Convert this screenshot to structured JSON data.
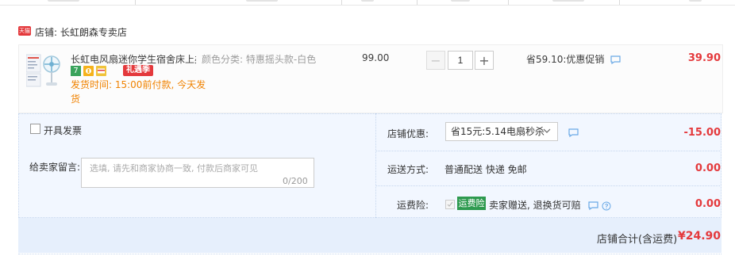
{
  "shop": {
    "name": "店铺: 长虹朗森专卖店",
    "badge": "天猫"
  },
  "item": {
    "title": "长虹电风扇迷你学生宿舍床上办...",
    "sku": "颜色分类: 特惠摇头款-白色",
    "price": "99.00",
    "quantity": "1",
    "minus": "−",
    "plus": "+",
    "promo": "省59.10:优惠促销",
    "total": "39.90",
    "badges": {
      "seven": "7",
      "gift": "礼遇季"
    },
    "ship_line1": "发货时间: 15:00前付款, 今天发",
    "ship_line2": "货"
  },
  "options": {
    "invoice_label": "开具发票",
    "message_label": "给卖家留言:",
    "message_placeholder": "选填, 请先和商家协商一致, 付款后商家可见",
    "message_count": "0/200"
  },
  "right": {
    "coupon_label": "店铺优惠:",
    "coupon_value": "省15元:5.14电扇秒杀",
    "coupon_discount": "-15.00",
    "ship_label": "运送方式:",
    "ship_value": "普通配送 快递 免邮",
    "ship_cost": "0.00",
    "ins_label": "运费险:",
    "ins_tag": "运费险",
    "ins_text": "卖家赠送, 退换货可赔",
    "ins_cost": "0.00"
  },
  "summary": {
    "label": "店铺合计(含运费)",
    "value": "¥24.90"
  },
  "colors": {
    "accent": "#e4393c",
    "ship_orange": "#f08200",
    "panel_bg": "#f2f7ff",
    "ins_green": "#2e9a4f"
  },
  "icons": [
    "tmall-badge-icon",
    "chat-icon",
    "help-icon",
    "chevron-down-icon"
  ]
}
